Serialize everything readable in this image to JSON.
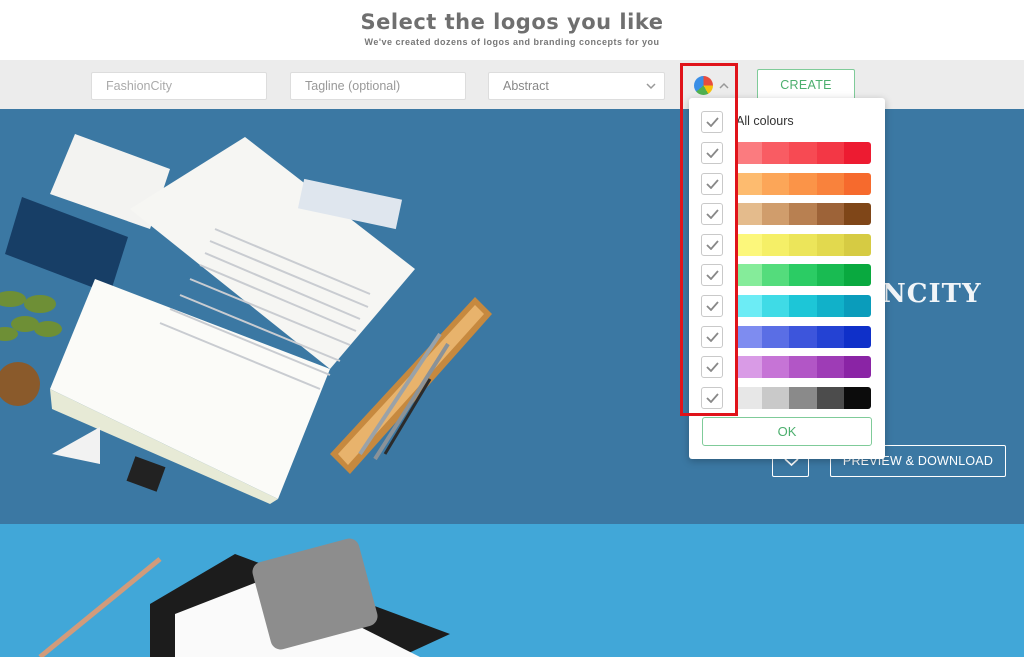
{
  "header": {
    "title": "Select the logos you like",
    "subtitle": "We've created dozens of logos and branding concepts for you"
  },
  "toolbar": {
    "brand_value": "FashionCity",
    "tagline_placeholder": "Tagline (optional)",
    "style_value": "Abstract",
    "create_label": "CREATE"
  },
  "mockup": {
    "logo_text": "NCITY",
    "preview_label": "PREVIEW & DOWNLOAD"
  },
  "color_dropdown": {
    "all_label": "All colours",
    "ok_label": "OK",
    "palettes": [
      {
        "name": "reds",
        "colors": [
          "#fb7b7f",
          "#f95c63",
          "#f74a53",
          "#f33745",
          "#ed1b31"
        ]
      },
      {
        "name": "oranges",
        "colors": [
          "#fdbb6f",
          "#fca658",
          "#fb9448",
          "#f9823c",
          "#f66a2d"
        ]
      },
      {
        "name": "browns",
        "colors": [
          "#e4bb8c",
          "#d09d6c",
          "#b88051",
          "#9d6338",
          "#7f4618"
        ]
      },
      {
        "name": "yellows",
        "colors": [
          "#fcf77b",
          "#f5ef67",
          "#ece55a",
          "#e2d94e",
          "#d6cb43"
        ]
      },
      {
        "name": "greens",
        "colors": [
          "#85ec9a",
          "#54dc7c",
          "#2bcc64",
          "#19bb52",
          "#09a93f"
        ]
      },
      {
        "name": "cyans",
        "colors": [
          "#6cecf5",
          "#3fdbe6",
          "#1dc6d7",
          "#11b1c9",
          "#0a9cbb"
        ]
      },
      {
        "name": "blues",
        "colors": [
          "#7e8cf0",
          "#5a6ee5",
          "#3d55dc",
          "#2442d3",
          "#0f30c9"
        ]
      },
      {
        "name": "purples",
        "colors": [
          "#d99be6",
          "#c674d6",
          "#b256c6",
          "#9e3cb6",
          "#8a24a5"
        ]
      },
      {
        "name": "greys",
        "colors": [
          "#e7e7e7",
          "#c9c9c9",
          "#8a8a8a",
          "#4c4c4c",
          "#0c0c0c"
        ]
      }
    ]
  }
}
